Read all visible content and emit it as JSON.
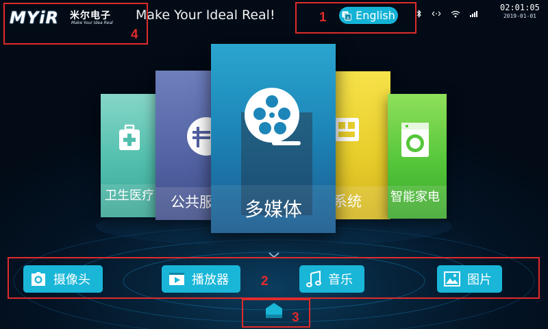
{
  "header": {
    "logo_text": "MYiR",
    "logo_cn": "米尔电子",
    "logo_tagline": "Make Your Idea Real",
    "slogan": "Make Your Ideal Real!",
    "language_button": "English",
    "clock_time": "02:01:05",
    "clock_date": "2019-01-01"
  },
  "carousel": {
    "cards": [
      {
        "id": "health",
        "label": "卫生医疗",
        "icon": "first-aid-kit-icon",
        "color": "#52bfae"
      },
      {
        "id": "public",
        "label": "公共服",
        "icon": "public-service-icon",
        "color": "#5262a3"
      },
      {
        "id": "media",
        "label": "多媒体",
        "icon": "film-reel-icon",
        "color": "#1d86b8"
      },
      {
        "id": "system",
        "label": "系统",
        "icon": "system-icon",
        "color": "#e9cf2c"
      },
      {
        "id": "home",
        "label": "智能家电",
        "icon": "washing-machine-icon",
        "color": "#55c63a"
      }
    ]
  },
  "bottom_apps": [
    {
      "id": "camera",
      "label": "摄像头",
      "icon": "camera-icon"
    },
    {
      "id": "player",
      "label": "播放器",
      "icon": "play-icon"
    },
    {
      "id": "music",
      "label": "音乐",
      "icon": "music-note-icon"
    },
    {
      "id": "pictures",
      "label": "图片",
      "icon": "picture-icon"
    }
  ],
  "annotations": [
    "1",
    "2",
    "3",
    "4"
  ],
  "colors": {
    "accent": "#19b6d8",
    "annotation": "#e12b2b"
  }
}
